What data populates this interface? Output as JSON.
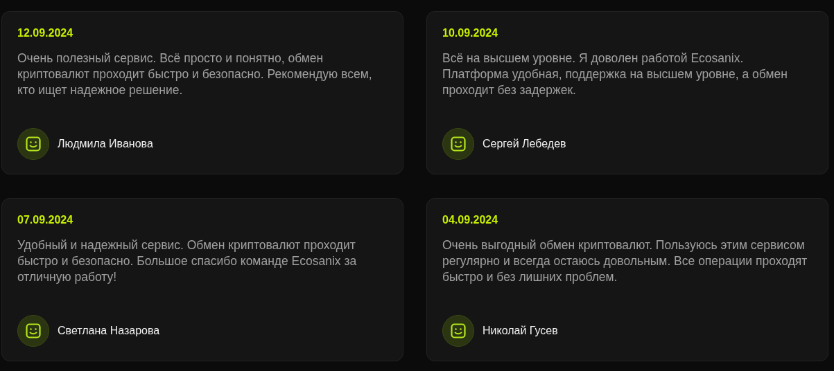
{
  "reviews": [
    {
      "date": "12.09.2024",
      "text": "Очень полезный сервис. Всё просто и понятно, обмен криптовалют проходит быстро и безопасно. Рекомендую всем, кто ищет надежное решение.",
      "author": "Людмила Иванова"
    },
    {
      "date": "10.09.2024",
      "text": "Всё на высшем уровне. Я доволен работой Ecosanix. Платформа удобная, поддержка на высшем уровне, а обмен проходит без задержек.",
      "author": "Сергей Лебедев"
    },
    {
      "date": "07.09.2024",
      "text": "Удобный и надежный сервис. Обмен криптовалют проходит быстро и безопасно. Большое спасибо команде Ecosanix за отличную работу!",
      "author": "Светлана Назарова"
    },
    {
      "date": "04.09.2024",
      "text": "Очень выгодный обмен криптовалют. Пользуюсь этим сервисом регулярно и всегда остаюсь довольным. Все операции проходят быстро и без лишних проблем.",
      "author": "Николай Гусев"
    }
  ]
}
